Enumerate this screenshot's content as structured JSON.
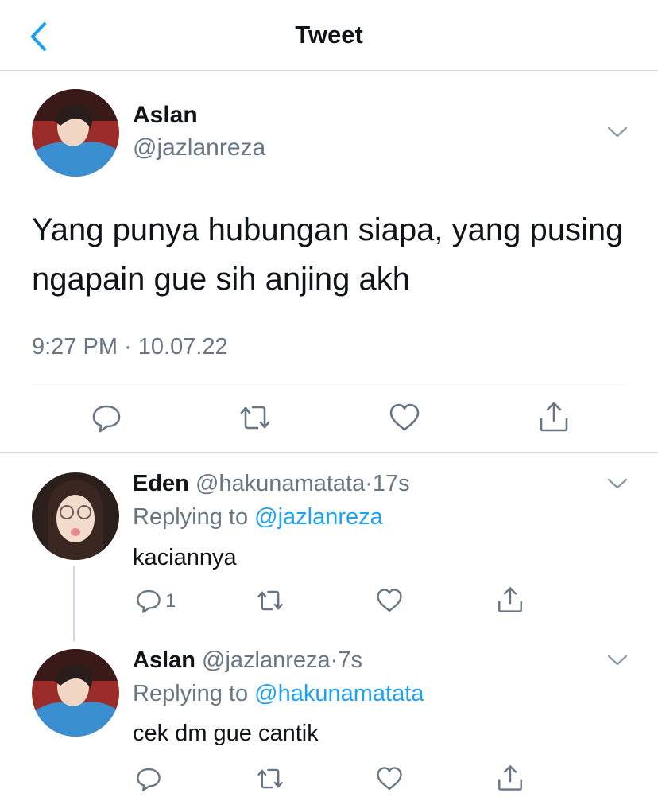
{
  "header": {
    "title": "Tweet",
    "back_icon": "chevron-left-icon",
    "accent": "#1da1f2"
  },
  "main_tweet": {
    "name": "Aslan",
    "handle": "@jazlanreza",
    "text": "Yang punya hubungan siapa, yang pusing ngapain gue sih anjing akh",
    "timestamp": "9:27 PM · 10.07.22",
    "actions": [
      "reply-icon",
      "retweet-icon",
      "like-icon",
      "share-icon"
    ]
  },
  "replies": [
    {
      "name": "Eden",
      "handle": "@hakunamatata",
      "separator": "·",
      "time": "17s",
      "replying_prefix": "Replying to",
      "replying_to": "@jazlanreza",
      "text": "kaciannya",
      "reply_count": "1"
    },
    {
      "name": "Aslan",
      "handle": "@jazlanreza",
      "separator": "·",
      "time": "7s",
      "replying_prefix": "Replying to",
      "replying_to": "@hakunamatata",
      "text": "cek dm gue cantik",
      "reply_count": ""
    }
  ],
  "colors": {
    "text": "#0f1419",
    "secondary": "#687684",
    "link": "#1da1f2",
    "divider": "#d6d9dc"
  }
}
